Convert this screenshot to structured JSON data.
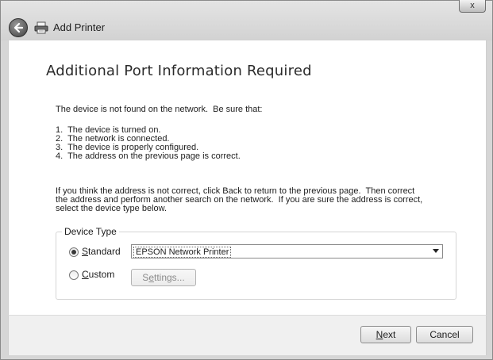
{
  "window": {
    "title": "Add Printer",
    "close_label": "x"
  },
  "page": {
    "heading": "Additional Port Information Required",
    "intro": "The device is not found on the network.  Be sure that:",
    "checklist": [
      "1.  The device is turned on.",
      "2.  The network is connected.",
      "3.  The device is properly configured.",
      "4.  The address on the previous page is correct."
    ],
    "advice": [
      "If you think the address is not correct, click Back to return to the previous page.  Then correct",
      "the address and perform another search on the network.  If you are sure the address is correct,",
      "select the device type below."
    ]
  },
  "device_type": {
    "group_label": "Device Type",
    "standard": {
      "accel": "S",
      "rest": "tandard",
      "selected": true
    },
    "custom": {
      "accel": "C",
      "rest": "ustom",
      "selected": false
    },
    "dropdown_value": "EPSON Network Printer",
    "settings_button": {
      "pre": "S",
      "accel": "e",
      "rest": "ttings..."
    }
  },
  "footer": {
    "next_button": {
      "accel": "N",
      "rest": "ext"
    },
    "cancel_label": "Cancel"
  }
}
